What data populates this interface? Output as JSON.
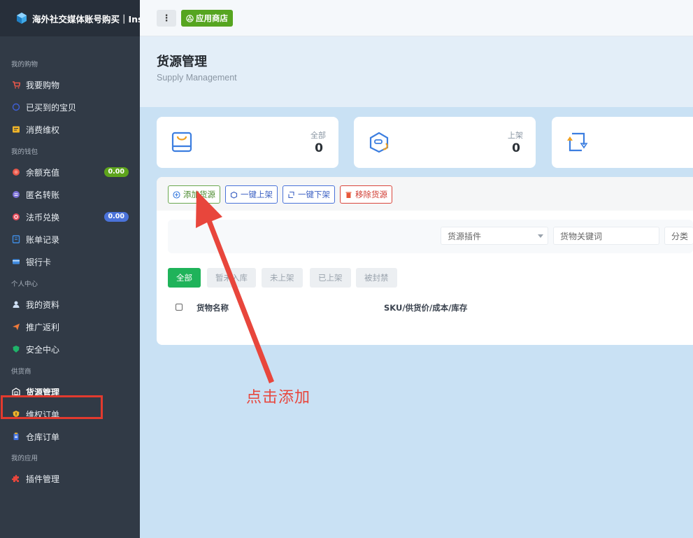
{
  "app": {
    "title": "海外社交媒体账号购买｜Ins"
  },
  "topbar": {
    "menu_label": "⋮",
    "store_label": "应用商店"
  },
  "sidebar": {
    "sections": [
      {
        "title": "我的购物",
        "items": [
          {
            "label": "我要购物",
            "icon": "cart-icon"
          },
          {
            "label": "已买到的宝贝",
            "icon": "circle-icon"
          },
          {
            "label": "消费维权",
            "icon": "note-icon"
          }
        ]
      },
      {
        "title": "我的钱包",
        "items": [
          {
            "label": "余额充值",
            "icon": "coin-icon",
            "badge": "0.00",
            "badge_color": "#5ea41c"
          },
          {
            "label": "匿名转账",
            "icon": "transfer-icon"
          },
          {
            "label": "法币兑换",
            "icon": "exchange-icon",
            "badge": "0.00",
            "badge_color": "#4a72d9"
          },
          {
            "label": "账单记录",
            "icon": "bill-icon"
          },
          {
            "label": "银行卡",
            "icon": "card-icon"
          }
        ]
      },
      {
        "title": "个人中心",
        "items": [
          {
            "label": "我的资料",
            "icon": "user-icon"
          },
          {
            "label": "推广返利",
            "icon": "send-icon"
          },
          {
            "label": "安全中心",
            "icon": "shield-icon"
          }
        ]
      },
      {
        "title": "供货商",
        "items": [
          {
            "label": "货源管理",
            "icon": "supply-icon",
            "active": true
          },
          {
            "label": "维权订单",
            "icon": "warning-shield-icon"
          },
          {
            "label": "仓库订单",
            "icon": "warehouse-icon"
          }
        ]
      },
      {
        "title": "我的应用",
        "items": [
          {
            "label": "插件管理",
            "icon": "puzzle-icon"
          }
        ]
      }
    ]
  },
  "page": {
    "title": "货源管理",
    "subtitle": "Supply Management"
  },
  "stats": [
    {
      "label": "全部",
      "value": "0",
      "icon": "bag-icon"
    },
    {
      "label": "上架",
      "value": "0",
      "icon": "box-up-icon"
    },
    {
      "label": "",
      "value": "",
      "icon": "cycle-icon"
    }
  ],
  "toolbar": {
    "add": "添加货源",
    "list_all": "一键上架",
    "delist_all": "一键下架",
    "remove": "移除货源"
  },
  "filters": {
    "plugin_placeholder": "货源插件",
    "keyword_placeholder": "货物关键词",
    "category_label": "分类"
  },
  "tabs": [
    "全部",
    "暂未入库",
    "未上架",
    "已上架",
    "被封禁"
  ],
  "table": {
    "columns": [
      "货物名称",
      "SKU/供货价/成本/库存"
    ]
  },
  "annotation": {
    "text": "点击添加",
    "color": "#e8463c"
  }
}
